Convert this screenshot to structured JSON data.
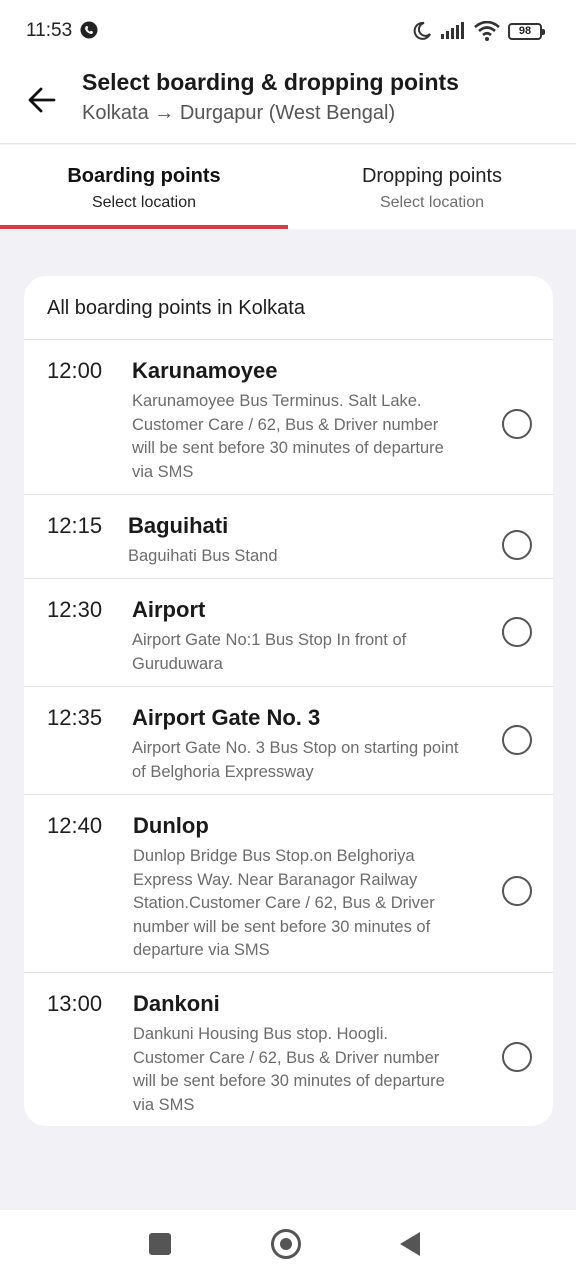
{
  "status_bar": {
    "time": "11:53",
    "battery": "98",
    "icons": [
      "call-icon",
      "moon-icon",
      "signal-icon",
      "wifi-icon",
      "battery-icon"
    ]
  },
  "header": {
    "title": "Select boarding & dropping points",
    "subtitle": "Kolkata → Durgapur (West Bengal)",
    "back_icon": "back-arrow-icon"
  },
  "tabs": [
    {
      "label": "Boarding points",
      "sub": "Select location",
      "active": true
    },
    {
      "label": "Dropping points",
      "sub": "Select location",
      "active": false
    }
  ],
  "colors": {
    "accent": "#d63b45",
    "background": "#f2f1f6"
  },
  "boarding": {
    "title": "All boarding points in Kolkata",
    "points": [
      {
        "time": "12:00",
        "name": "Karunamoyee",
        "desc": "Karunamoyee Bus Terminus. Salt Lake. Customer Care / 62, Bus & Driver number will be sent before 30 minutes of departure via SMS",
        "selected": false
      },
      {
        "time": "12:15",
        "name": "Baguihati",
        "desc": "Baguihati Bus Stand",
        "selected": false
      },
      {
        "time": "12:30",
        "name": "Airport",
        "desc": "Airport Gate No:1 Bus Stop In front of Guruduwara",
        "selected": false
      },
      {
        "time": "12:35",
        "name": "Airport Gate No. 3",
        "desc": "Airport Gate No. 3 Bus Stop on starting point of Belghoria Expressway",
        "selected": false
      },
      {
        "time": "12:40",
        "name": "Dunlop",
        "desc": "Dunlop Bridge Bus Stop.on Belghoriya Express Way. Near Baranagor Railway Station.Customer Care / 62, Bus & Driver number will be sent before 30 minutes of departure via SMS",
        "selected": false
      },
      {
        "time": "13:00",
        "name": "Dankoni",
        "desc": "Dankuni Housing Bus stop.  Hoogli. Customer Care / 62, Bus & Driver number will be sent before 30 minutes of departure via SMS",
        "selected": false
      }
    ]
  },
  "nav_bar": [
    "recents-square-icon",
    "home-circle-icon",
    "back-triangle-icon"
  ]
}
